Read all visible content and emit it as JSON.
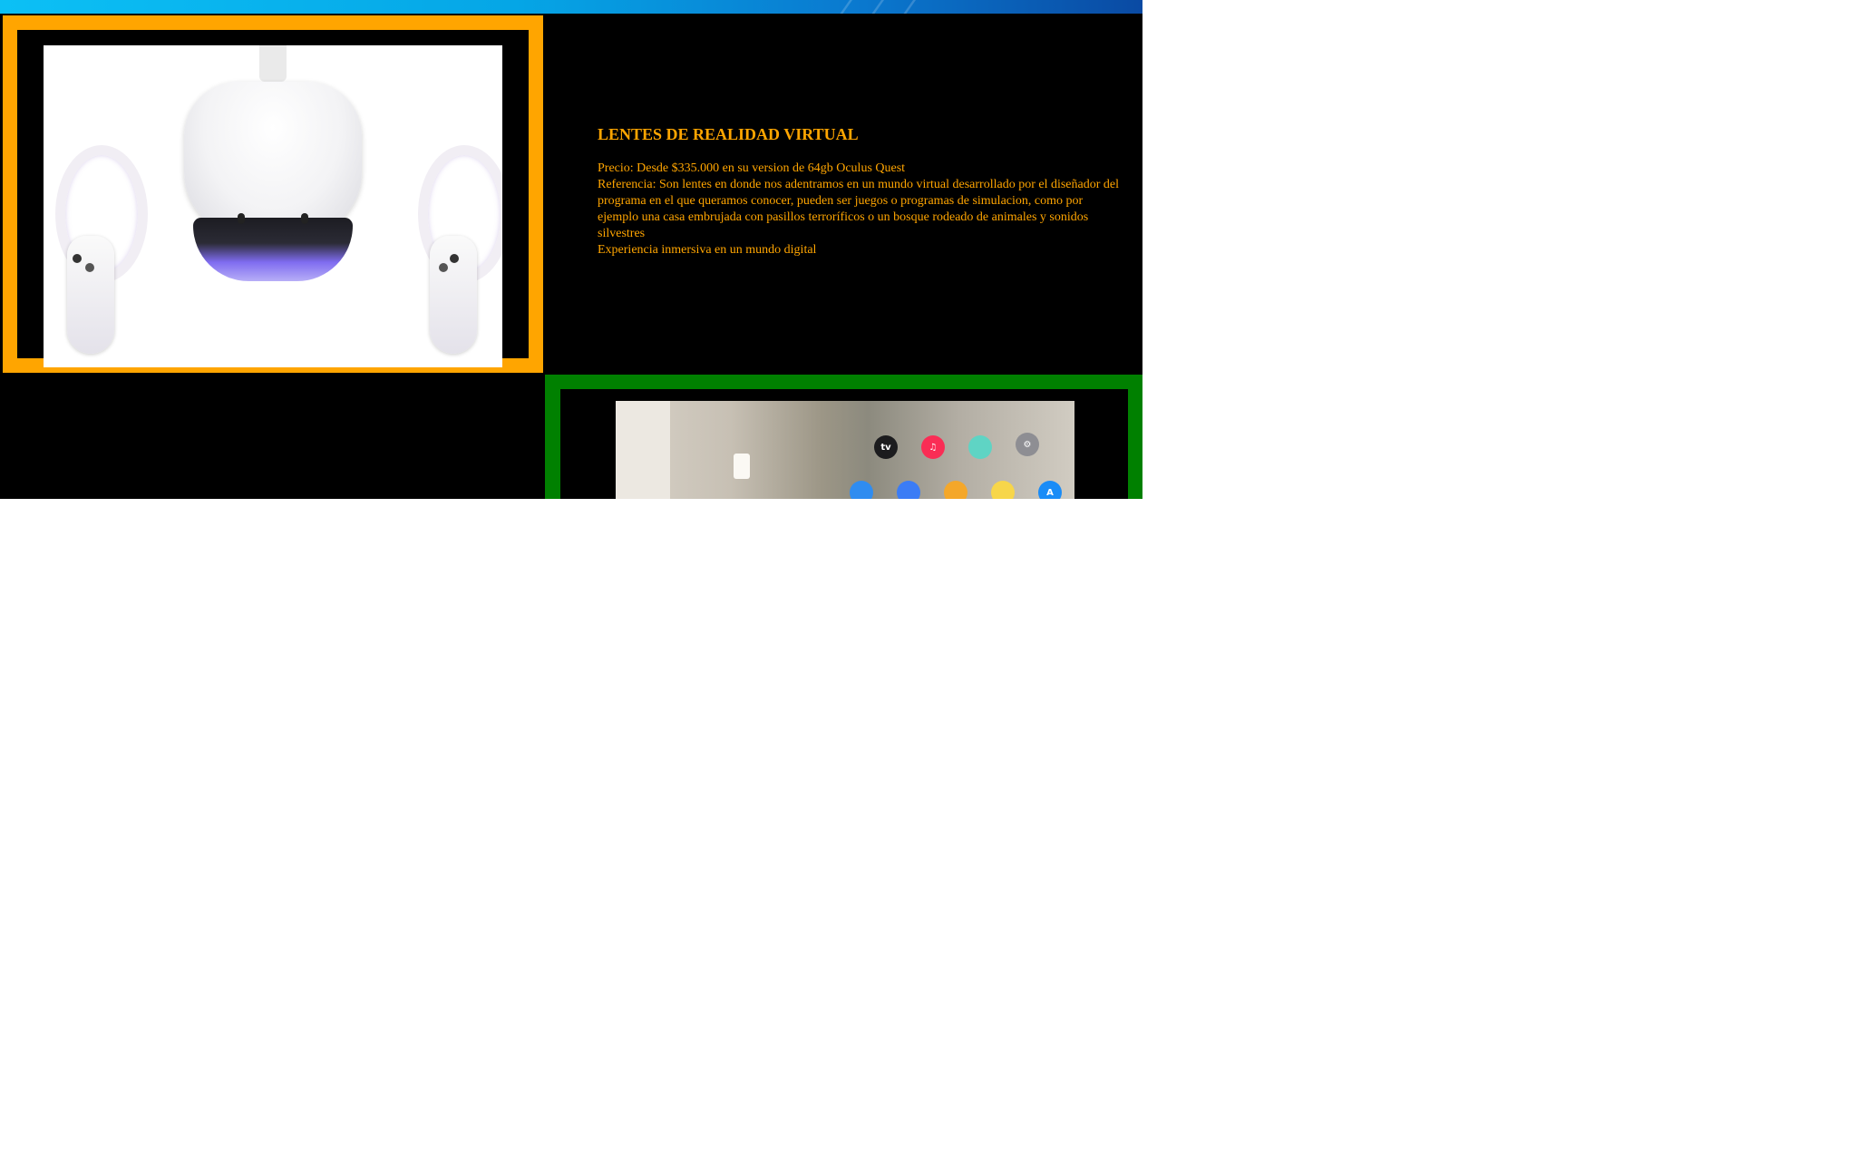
{
  "product_vr": {
    "title": "LENTES DE REALIDAD VIRTUAL",
    "price": "Precio: Desde $335.000 en su version de 64gb Oculus Quest",
    "reference": "Referencia: Son lentes en donde nos adentramos en un mundo virtual desarrollado por el diseñador del programa en el que queramos conocer, pueden ser juegos o programas de simulacion, como por ejemplo una casa embrujada con pasillos terroríficos o un bosque rodeado de animales y sonidos silvestres",
    "experience": "Experiencia inmersiva en un mundo digital"
  },
  "product_ar": {
    "app_icons": [
      {
        "icon": "apple-tv-icon",
        "label": "tv",
        "color": "#1c1c1e"
      },
      {
        "icon": "music-icon",
        "label": "♫",
        "color": "#fa2d55"
      },
      {
        "icon": "mindfulness-icon",
        "label": "",
        "color": "#5fd4c4"
      },
      {
        "icon": "settings-icon",
        "label": "⚙",
        "color": "#8e8e93"
      },
      {
        "icon": "safari-icon",
        "label": "",
        "color": "#2f8cf0"
      },
      {
        "icon": "keynote-icon",
        "label": "",
        "color": "#3b7cf5"
      },
      {
        "icon": "photos-icon",
        "label": "",
        "color": "#f4a72a"
      },
      {
        "icon": "notes-icon",
        "label": "",
        "color": "#f7d64a"
      },
      {
        "icon": "app-store-icon",
        "label": "A",
        "color": "#1a8cf7"
      }
    ]
  },
  "colors": {
    "vr_accent": "#ffa500",
    "ar_accent": "#008000",
    "banner": "#0cc0f5"
  }
}
